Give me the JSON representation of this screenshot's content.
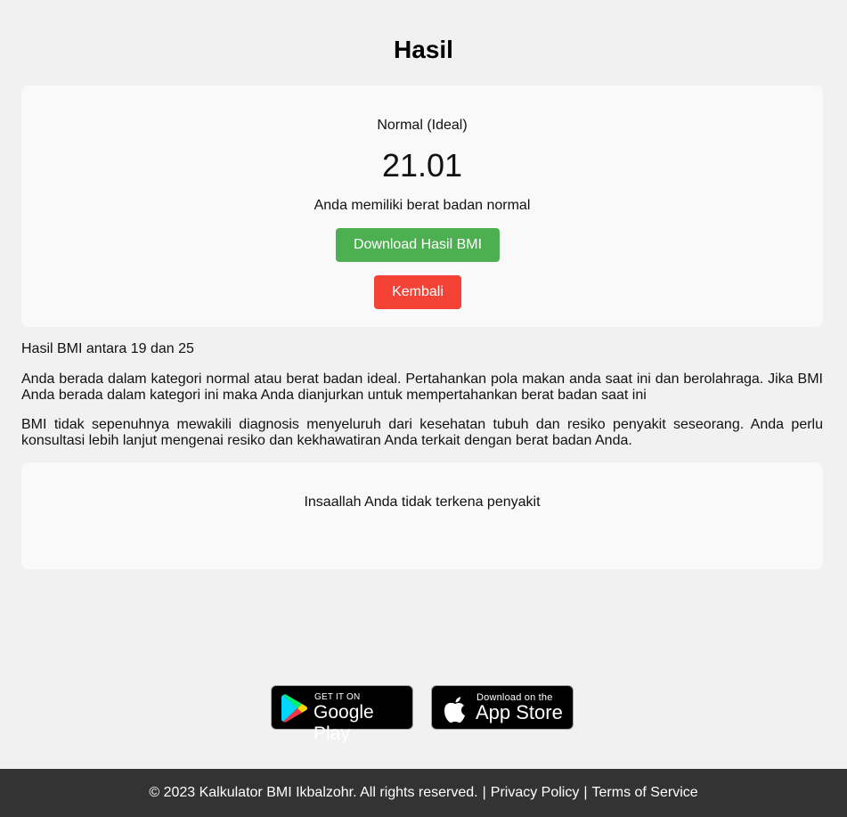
{
  "page": {
    "title": "Hasil"
  },
  "result": {
    "category": "Normal (Ideal)",
    "score": "21.01",
    "message": "Anda memiliki berat badan normal",
    "download_label": "Download Hasil BMI",
    "back_label": "Kembali",
    "download_color": "#4caf50",
    "back_color": "#f44336"
  },
  "info": {
    "range": "Hasil BMI antara 19 dan 25",
    "advice": "Anda berada dalam kategori normal atau berat badan ideal. Pertahankan pola makan anda saat ini dan berolahraga. Jika BMI Anda berada dalam kategori ini maka Anda dianjurkan untuk mempertahankan berat badan saat ini",
    "disclaimer": "BMI tidak sepenuhnya mewakili diagnosis menyeluruh dari kesehatan tubuh dan resiko penyakit seseorang. Anda perlu konsultasi lebih lanjut mengenai resiko dan kekhawatiran Anda terkait dengan berat badan Anda."
  },
  "disease": {
    "text": "Insaallah Anda tidak terkena penyakit"
  },
  "stores": {
    "google": {
      "small": "GET IT ON",
      "big": "Google Play",
      "icon": "google-play-icon"
    },
    "apple": {
      "small": "Download on the",
      "big": "App Store",
      "icon": "apple-icon"
    }
  },
  "footer": {
    "copyright": "© 2023 Kalkulator BMI Ikbalzohr. All rights reserved.",
    "separator": "|",
    "privacy": "Privacy Policy",
    "terms": "Terms of Service"
  }
}
